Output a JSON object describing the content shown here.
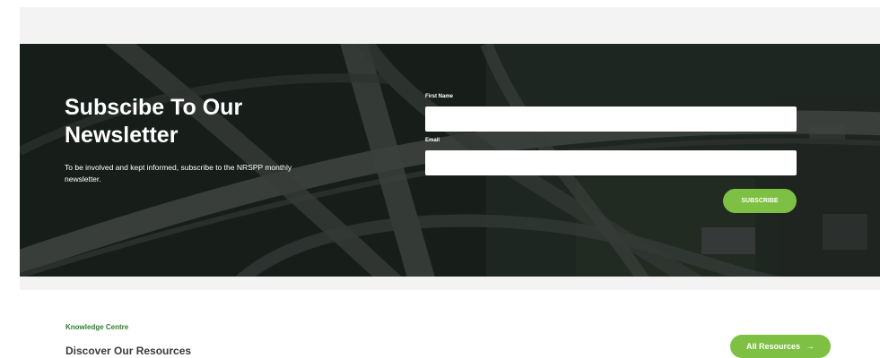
{
  "newsletter": {
    "title": "Subscibe To Our Newsletter",
    "description": "To be involved and kept informed, subscribe to the NRSPP monthly newsletter.",
    "first_name_label": "First Name",
    "first_name_value": "",
    "email_label": "Email",
    "email_value": "",
    "subscribe_label": "SUBSCRIBE",
    "accent_color": "#7ec043",
    "background_image": "aerial-highway-interchange"
  },
  "knowledge": {
    "section_label": "Knowledge Centre",
    "title": "Discover Our Resources",
    "button_label": "All Resources",
    "button_icon": "arrow-right-icon",
    "label_color": "#2f7d32"
  }
}
